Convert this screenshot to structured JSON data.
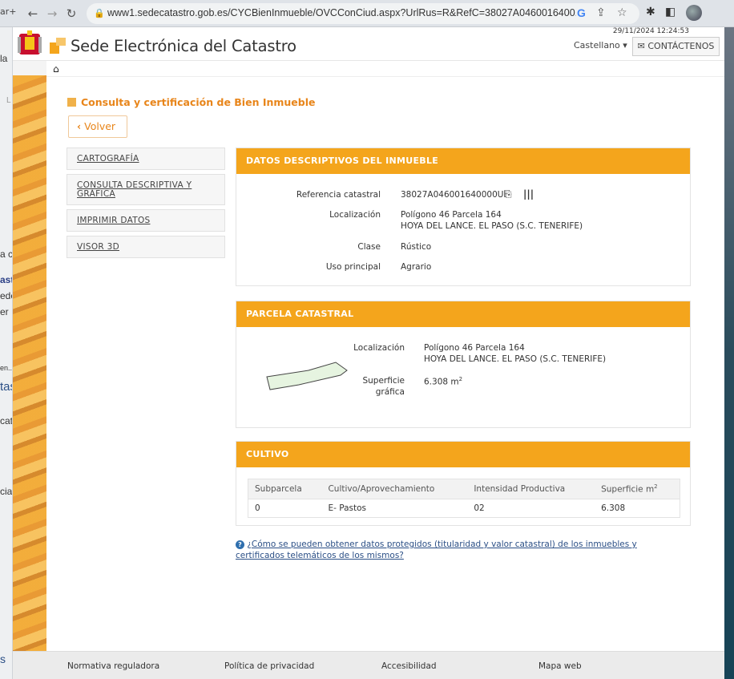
{
  "browser": {
    "url": "www1.sedecatastro.gob.es/OVCFrames.aspx?TIPO=... /CYCBienInmueble/OVCConCiud.aspx?UrlBrus=R&RefC=38027A0460016400...",
    "url_display": "www1.sedecatastro.gob.es/CYCBienInmueble/OVCConCiud.aspx?UrlRus=R&RefC=38027A0460016400...",
    "tab_peek": "ar+",
    "icons": [
      "back-icon",
      "forward-icon",
      "reload-icon",
      "lock-icon",
      "google-icon",
      "share-icon",
      "star-icon",
      "extensions-icon",
      "sidepanel-icon"
    ]
  },
  "desktop": {
    "fragments": [
      "la",
      "L",
      "a ca",
      "ast",
      "ede",
      "er",
      "en...",
      "tas",
      "cat",
      "cia",
      "s"
    ]
  },
  "header": {
    "datetime": "29/11/2024  12:24:53",
    "site_title": "Sede Electrónica del Catastro",
    "language": "Castellano",
    "contact_label": "CONTÁCTENOS"
  },
  "main": {
    "heading": "Consulta y certificación de Bien Inmueble",
    "back_label": "Volver"
  },
  "menu": {
    "items": [
      {
        "label": "CARTOGRAFÍA"
      },
      {
        "label": "CONSULTA DESCRIPTIVA Y GRÁFICA"
      },
      {
        "label": "IMPRIMIR DATOS"
      },
      {
        "label": "VISOR 3D"
      }
    ]
  },
  "datos": {
    "title": "DATOS DESCRIPTIVOS DEL INMUEBLE",
    "ref_label": "Referencia catastral",
    "ref_value": "38027A046001640000UI",
    "loc_label": "Localización",
    "loc_line1": "Polígono 46 Parcela 164",
    "loc_line2": "HOYA DEL LANCE. EL PASO (S.C. TENERIFE)",
    "clase_label": "Clase",
    "clase_value": "Rústico",
    "uso_label": "Uso principal",
    "uso_value": "Agrario"
  },
  "parcela": {
    "title": "PARCELA CATASTRAL",
    "loc_label": "Localización",
    "loc_line1": "Polígono 46 Parcela 164",
    "loc_line2": "HOYA DEL LANCE. EL PASO (S.C. TENERIFE)",
    "sup_label_1": "Superficie",
    "sup_label_2": "gráfica",
    "sup_value": "6.308",
    "sup_unit": "m",
    "sup_exp": "2"
  },
  "cultivo": {
    "title": "CULTIVO",
    "columns": [
      "Subparcela",
      "Cultivo/Aprovechamiento",
      "Intensidad Productiva",
      "Superficie m"
    ],
    "col_exp": "2",
    "rows": [
      [
        "0",
        "E- Pastos",
        "02",
        "6.308"
      ]
    ]
  },
  "help": {
    "text": "¿Cómo se pueden obtener datos protegidos (titularidad y valor catastral) de los inmuebles y certificados telemáticos de los mismos?"
  },
  "footer": {
    "links": [
      "Normativa reguladora",
      "Política de privacidad",
      "Accesibilidad",
      "Mapa web"
    ]
  },
  "colors": {
    "accent": "#f4a51c",
    "accent_text": "#e8851a",
    "link": "#2b4f86"
  }
}
